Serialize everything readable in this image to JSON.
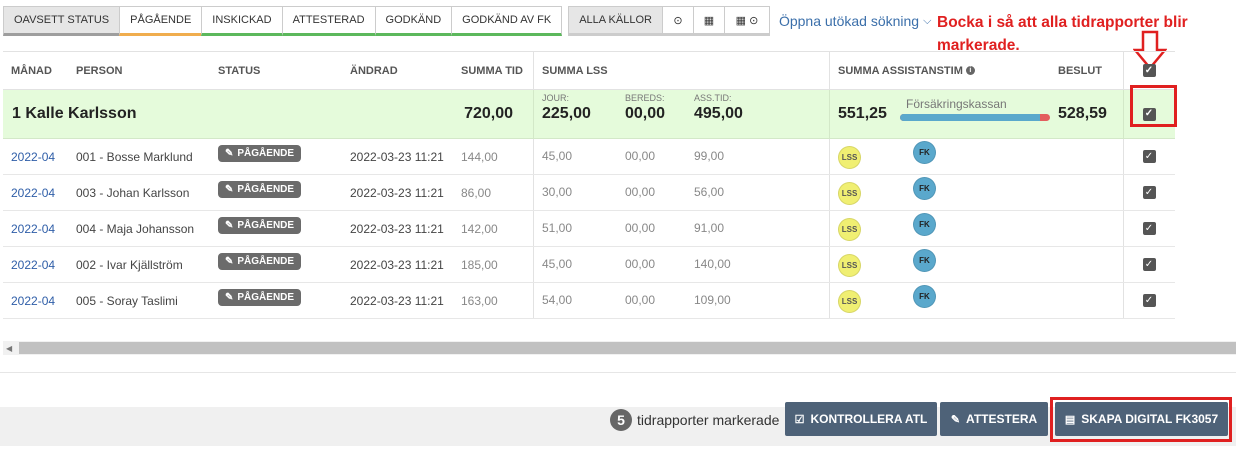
{
  "filters": {
    "buttons": [
      {
        "label": "OAVSETT STATUS",
        "active": true
      },
      {
        "label": "PÅGÅENDE"
      },
      {
        "label": "INSKICKAD"
      },
      {
        "label": "ATTESTERAD"
      },
      {
        "label": "GODKÄND"
      },
      {
        "label": "GODKÄND AV FK"
      }
    ],
    "sources_label": "ALLA KÄLLOR",
    "expand_search": "Öppna utökad sökning"
  },
  "annotation": "Bocka i så att alla tidrapporter blir markerade.",
  "table": {
    "headers": {
      "month": "MÅNAD",
      "person": "PERSON",
      "status": "STATUS",
      "changed": "ÄNDRAD",
      "sum_time": "SUMMA TID",
      "sum_lss": "SUMMA LSS",
      "sum_assist": "SUMMA ASSISTANSTIM",
      "decision": "BESLUT"
    },
    "group": {
      "name": "1 Kalle Karlsson",
      "sum_time": "720,00",
      "jour_label": "JOUR:",
      "jour": "225,00",
      "bereds_label": "BEREDS:",
      "bereds": "00,00",
      "asstid_label": "ASS.TID:",
      "asstid": "495,00",
      "assist_total": "551,25",
      "insurer_label": "Försäkringskassan",
      "progress_fraction": 0.93,
      "decision": "528,59"
    },
    "rows": [
      {
        "month": "2022-04",
        "person": "001 - Bosse Marklund",
        "status": "PÅGÅENDE",
        "changed": "2022-03-23 11:21",
        "sum_time": "144,00",
        "jour": "45,00",
        "bereds": "00,00",
        "asstid": "99,00",
        "lss": "LSS",
        "fk": "FK"
      },
      {
        "month": "2022-04",
        "person": "003 - Johan Karlsson",
        "status": "PÅGÅENDE",
        "changed": "2022-03-23 11:21",
        "sum_time": "86,00",
        "jour": "30,00",
        "bereds": "00,00",
        "asstid": "56,00",
        "lss": "LSS",
        "fk": "FK"
      },
      {
        "month": "2022-04",
        "person": "004 - Maja Johansson",
        "status": "PÅGÅENDE",
        "changed": "2022-03-23 11:21",
        "sum_time": "142,00",
        "jour": "51,00",
        "bereds": "00,00",
        "asstid": "91,00",
        "lss": "LSS",
        "fk": "FK"
      },
      {
        "month": "2022-04",
        "person": "002 - Ivar Kjällström",
        "status": "PÅGÅENDE",
        "changed": "2022-03-23 11:21",
        "sum_time": "185,00",
        "jour": "45,00",
        "bereds": "00,00",
        "asstid": "140,00",
        "lss": "LSS",
        "fk": "FK"
      },
      {
        "month": "2022-04",
        "person": "005 - Soray Taslimi",
        "status": "PÅGÅENDE",
        "changed": "2022-03-23 11:21",
        "sum_time": "163,00",
        "jour": "54,00",
        "bereds": "00,00",
        "asstid": "109,00",
        "lss": "LSS",
        "fk": "FK"
      }
    ]
  },
  "footer": {
    "selected_count": "5",
    "selected_text": "tidrapporter markerade",
    "check_atl": "KONTROLLERA ATL",
    "attest": "ATTESTERA",
    "create_fk": "SKAPA DIGITAL FK3057"
  },
  "colors": {
    "accent_red": "#e02020",
    "button": "#4e6278",
    "group_bg": "#e5fbdb"
  }
}
